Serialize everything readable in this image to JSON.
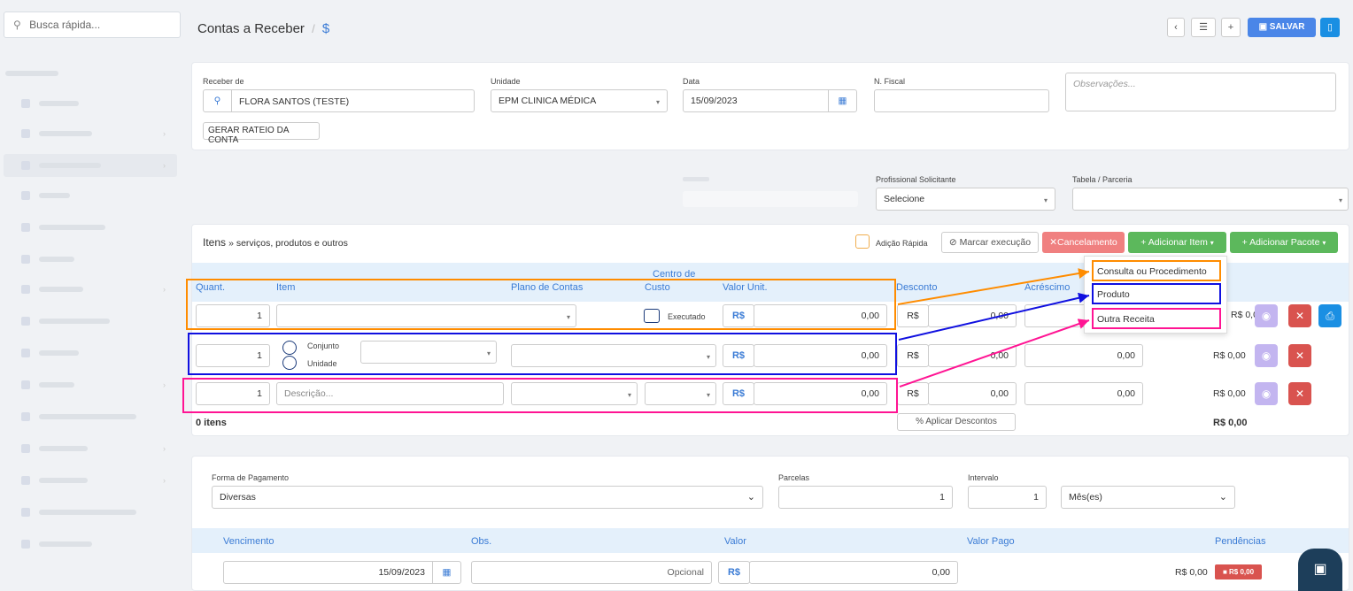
{
  "sidebar": {
    "search_placeholder": "Busca rápida...",
    "search_icon": "search-icon"
  },
  "header": {
    "title": "Contas a Receber",
    "separator": "/",
    "currency_symbol": "$",
    "save_label": "SALVAR",
    "save_icon": "floppy-icon"
  },
  "form": {
    "receber_de_label": "Receber de",
    "receber_de_value": "FLORA SANTOS (TESTE)",
    "unidade_label": "Unidade",
    "unidade_value": "EPM CLINICA MÉDICA",
    "data_label": "Data",
    "data_value": "15/09/2023",
    "nfiscal_label": "N. Fiscal",
    "nfiscal_value": "",
    "observacoes_placeholder": "Observações...",
    "rateio_button": "GERAR RATEIO DA CONTA",
    "profissional_label": "Profissional Solicitante",
    "profissional_value": "Selecione",
    "tabela_label": "Tabela / Parceria",
    "tabela_value": ""
  },
  "items": {
    "title": "Itens",
    "subtitle": "» serviços, produtos e outros",
    "adicao_rapida": "Adição Rápida",
    "marcar_execucao": "Marcar execução",
    "cancelamento": "Cancelamento",
    "adicionar_item": "+ Adicionar Item",
    "adicionar_pacote": "+ Adicionar Pacote",
    "columns": {
      "quant": "Quant.",
      "item": "Item",
      "plano": "Plano de Contas",
      "centro_1": "Centro de",
      "centro_2": "Custo",
      "valor_unit": "Valor Unit.",
      "desconto": "Desconto",
      "acrescimo": "Acréscimo"
    },
    "rows": [
      {
        "quant": "1",
        "executado": "Executado",
        "rs": "R$",
        "valor": "0,00",
        "desc_rs": "R$",
        "desconto": "0,00",
        "total": "R$ 0,00"
      },
      {
        "quant": "1",
        "conjunto": "Conjunto",
        "unidade": "Unidade",
        "rs": "R$",
        "valor": "0,00",
        "desc_rs": "R$",
        "desconto": "0,00",
        "acrescimo": "0,00",
        "total": "R$ 0,00"
      },
      {
        "quant": "1",
        "descricao_placeholder": "Descrição...",
        "rs": "R$",
        "valor": "0,00",
        "desc_rs": "R$",
        "desconto": "0,00",
        "acrescimo": "0,00",
        "total": "R$ 0,00"
      }
    ],
    "count": "0 itens",
    "aplicar_descontos": "Aplicar Descontos",
    "total": "R$ 0,00"
  },
  "dropdown": {
    "options": [
      "Consulta ou Procedimento",
      "Produto",
      "Outra Receita"
    ]
  },
  "payment": {
    "forma_label": "Forma de Pagamento",
    "forma_value": "Diversas",
    "parcelas_label": "Parcelas",
    "parcelas_value": "1",
    "intervalo_label": "Intervalo",
    "intervalo_value": "1",
    "periodo_value": "Mês(es)",
    "columns": {
      "vencimento": "Vencimento",
      "obs": "Obs.",
      "valor": "Valor",
      "valor_pago": "Valor Pago",
      "pendencias": "Pendências"
    },
    "row": {
      "vencimento": "15/09/2023",
      "obs_placeholder": "Opcional",
      "rs": "R$",
      "valor": "0,00",
      "valor_pago": "R$ 0,00",
      "pendencia_badge": "R$ 0,00"
    }
  },
  "colors": {
    "accent_blue": "#3a7bd5",
    "orange": "#ff8c00",
    "blue_annot": "#1010e0",
    "pink_annot": "#ff1493",
    "green": "#5cb85c",
    "danger": "#d9534f"
  }
}
